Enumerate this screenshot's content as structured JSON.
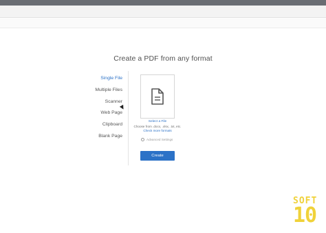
{
  "page": {
    "heading": "Create a PDF from any format"
  },
  "sidebar": {
    "items": [
      {
        "label": "Single File",
        "active": true
      },
      {
        "label": "Multiple Files",
        "active": false
      },
      {
        "label": "Scanner",
        "active": false
      },
      {
        "label": "Web Page",
        "active": false
      },
      {
        "label": "Clipboard",
        "active": false
      },
      {
        "label": "Blank Page",
        "active": false
      }
    ]
  },
  "upload": {
    "select_link": "Select a File",
    "hint": "Choose from .docx, .xlsx, .txt, etc.",
    "more_link": "Check more formats",
    "advanced": "Advanced Settings",
    "create_label": "Create",
    "icon": "document-icon"
  },
  "watermark": {
    "top": "SOFT",
    "bottom": "10"
  },
  "colors": {
    "accent": "#2c72c7",
    "topbar": "#6a6d73",
    "watermark": "#f0d23a"
  }
}
